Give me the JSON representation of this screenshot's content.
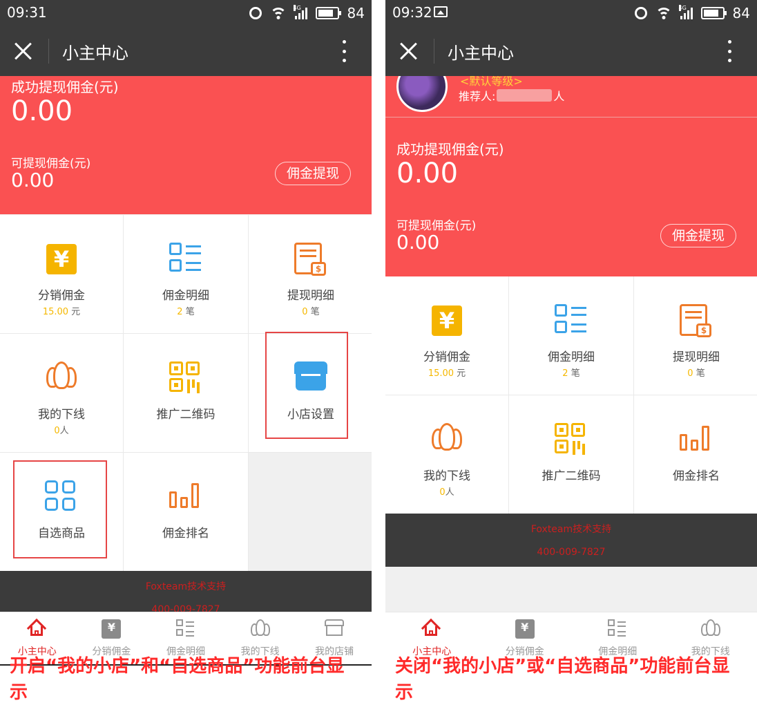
{
  "colors": {
    "primary_red": "#fa5152",
    "dark_bar": "#3b3b3b",
    "accent_yellow": "#f5b400",
    "icon_blue": "#3ba3e8",
    "icon_orange": "#ee7b2a",
    "caption_red": "#ff2a2a"
  },
  "left": {
    "status": {
      "time": "09:31",
      "battery": "84",
      "battery_level": 0.84
    },
    "titlebar": {
      "title": "小主中心"
    },
    "commission": {
      "success_label": "成功提现佣金(元)",
      "success_value": "0.00",
      "available_label": "可提现佣金(元)",
      "available_value": "0.00",
      "withdraw_button": "佣金提现"
    },
    "grid": {
      "distribution": {
        "name": "分销佣金",
        "count": "15.00",
        "unit": "元"
      },
      "commission_detail": {
        "name": "佣金明细",
        "count": "2",
        "unit": "笔"
      },
      "withdraw_detail": {
        "name": "提现明细",
        "count": "0",
        "unit": "笔"
      },
      "downline": {
        "name": "我的下线",
        "count": "0",
        "unit": "人"
      },
      "qrcode": {
        "name": "推广二维码"
      },
      "shop_settings": {
        "name": "小店设置"
      },
      "select_goods": {
        "name": "自选商品"
      },
      "ranking": {
        "name": "佣金排名"
      }
    },
    "footer": {
      "support": "Foxteam技术支持",
      "phone": "400-009-7827"
    },
    "tabs": [
      "小主中心",
      "分销佣金",
      "佣金明细",
      "我的下线",
      "我的店铺"
    ],
    "caption": "开启“我的小店”和“自选商品”功能前台显示"
  },
  "right": {
    "status": {
      "time": "09:32",
      "battery": "84",
      "battery_level": 0.84
    },
    "titlebar": {
      "title": "小主中心"
    },
    "profile": {
      "level": "<默认等级>",
      "referrer_prefix": "推荐人:",
      "referrer_suffix": "人"
    },
    "commission": {
      "success_label": "成功提现佣金(元)",
      "success_value": "0.00",
      "available_label": "可提现佣金(元)",
      "available_value": "0.00",
      "withdraw_button": "佣金提现"
    },
    "grid": {
      "distribution": {
        "name": "分销佣金",
        "count": "15.00",
        "unit": "元"
      },
      "commission_detail": {
        "name": "佣金明细",
        "count": "2",
        "unit": "笔"
      },
      "withdraw_detail": {
        "name": "提现明细",
        "count": "0",
        "unit": "笔"
      },
      "downline": {
        "name": "我的下线",
        "count": "0",
        "unit": "人"
      },
      "qrcode": {
        "name": "推广二维码"
      },
      "ranking": {
        "name": "佣金排名"
      }
    },
    "footer": {
      "support": "Foxteam技术支持",
      "phone": "400-009-7827"
    },
    "tabs": [
      "小主中心",
      "分销佣金",
      "佣金明细",
      "我的下线"
    ],
    "caption": "关闭“我的小店”或“自选商品”功能前台显示"
  }
}
